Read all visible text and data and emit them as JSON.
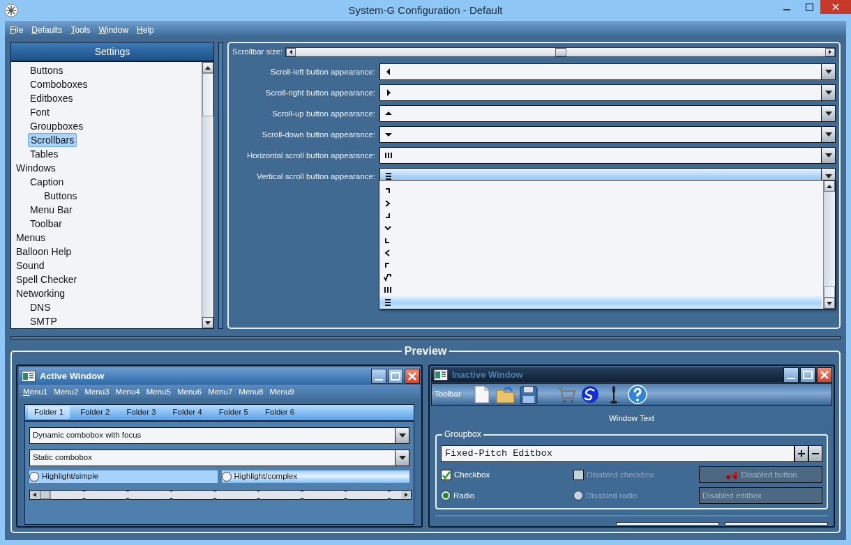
{
  "window": {
    "title": "System-G Configuration - Default"
  },
  "menu": [
    {
      "label": "File"
    },
    {
      "label": "Defaults"
    },
    {
      "label": "Tools"
    },
    {
      "label": "Window"
    },
    {
      "label": "Help"
    }
  ],
  "settings": {
    "title": "Settings",
    "tree": [
      {
        "children": [
          {
            "label": "Buttons",
            "selected": false
          },
          {
            "label": "Comboboxes",
            "selected": false
          },
          {
            "label": "Editboxes",
            "selected": false
          },
          {
            "label": "Font",
            "selected": false
          },
          {
            "label": "Groupboxes",
            "selected": false
          },
          {
            "label": "Scrollbars",
            "selected": true
          },
          {
            "label": "Tables",
            "selected": false
          }
        ]
      },
      {
        "label": "Windows",
        "selected": false,
        "children": [
          {
            "label": "Caption",
            "selected": false,
            "children": [
              {
                "label": "Buttons",
                "selected": false
              }
            ]
          },
          {
            "label": "Menu Bar",
            "selected": false
          },
          {
            "label": "Toolbar",
            "selected": false
          }
        ]
      },
      {
        "label": "Menus",
        "selected": false
      },
      {
        "label": "Balloon Help",
        "selected": false
      },
      {
        "label": "Sound",
        "selected": false
      },
      {
        "label": "Spell Checker",
        "selected": false
      },
      {
        "label": "Networking",
        "selected": false,
        "children": [
          {
            "label": "DNS",
            "selected": false
          },
          {
            "label": "SMTP",
            "selected": false
          }
        ]
      }
    ]
  },
  "scrollbar_size": {
    "label": "Scrollbar size:",
    "level": 0.5
  },
  "appearance": [
    {
      "label": "Scroll-left button appearance:",
      "value": {
        "kind": "arrow-left"
      },
      "open": false
    },
    {
      "label": "Scroll-right button appearance:",
      "value": {
        "kind": "arrow-right"
      },
      "open": false
    },
    {
      "label": "Scroll-up button appearance:",
      "value": {
        "kind": "arrow-up"
      },
      "open": false
    },
    {
      "label": "Scroll-down button appearance:",
      "value": {
        "kind": "arrow-down"
      },
      "open": false
    },
    {
      "label": "Horizontal scroll button appearance:",
      "value": {
        "kind": "bars-vertical"
      },
      "open": false
    },
    {
      "label": "Vertical scroll button appearance:",
      "value": {
        "kind": "bars-horizontal"
      },
      "open": true,
      "options": [
        {
          "kind": "corner-tr",
          "selected": false
        },
        {
          "kind": "chevron-right",
          "selected": false
        },
        {
          "kind": "corner-br",
          "selected": false
        },
        {
          "kind": "chevron-down",
          "selected": false
        },
        {
          "kind": "corner-bl",
          "selected": false
        },
        {
          "kind": "chevron-left",
          "selected": false
        },
        {
          "kind": "corner-tl",
          "selected": false
        },
        {
          "kind": "zigzag",
          "selected": false
        },
        {
          "kind": "bars-vertical",
          "selected": false
        },
        {
          "kind": "bars-horizontal",
          "selected": true
        }
      ]
    }
  ],
  "preview": {
    "title": "Preview",
    "active_window": {
      "title": "Active Window",
      "menus": [
        "Menu1",
        "Menu2",
        "Menu3",
        "Menu4",
        "Menu5",
        "Menu6",
        "Menu7",
        "Menu8",
        "Menu9"
      ],
      "tabs": [
        {
          "label": "Folder 1",
          "selected": true
        },
        {
          "label": "Folder 2",
          "selected": false
        },
        {
          "label": "Folder 3",
          "selected": false
        },
        {
          "label": "Folder 4",
          "selected": false
        },
        {
          "label": "Folder 5",
          "selected": false
        },
        {
          "label": "Folder 6",
          "selected": false
        }
      ],
      "comboboxes": [
        "Dynamic combobox with focus",
        "Static combobox"
      ],
      "highlights": [
        {
          "label": "Highlight/simple",
          "kind": "simple",
          "checked": false
        },
        {
          "label": "Highlight/complex",
          "kind": "complex",
          "checked": false
        }
      ],
      "slider": {
        "level": 0
      }
    },
    "inactive_window": {
      "title": "Inactive Window",
      "toolbar_label": "Toolbar",
      "toolbar_icons": [
        {
          "kind": "document"
        },
        {
          "kind": "folder"
        },
        {
          "kind": "disk"
        },
        {
          "kind": "cart"
        },
        {
          "kind": "swirl"
        },
        {
          "kind": "microphone"
        },
        {
          "kind": "help"
        }
      ],
      "window_text": "Window Text",
      "groupbox": {
        "title": "Groupbox",
        "editbox": "Fixed-Pitch Editbox",
        "checkboxes": [
          {
            "label": "Checkbox",
            "checked": true,
            "disabled": false
          },
          {
            "label": "Disabled checkbox",
            "checked": false,
            "disabled": true
          }
        ],
        "radios": [
          {
            "label": "Radio",
            "checked": true,
            "disabled": false
          },
          {
            "label": "Disabled radio",
            "checked": false,
            "disabled": true
          }
        ],
        "button": {
          "label": "Disabled button",
          "disabled": true
        },
        "disabled_editbox": {
          "placeholder": "Disabled editbox"
        }
      }
    }
  }
}
